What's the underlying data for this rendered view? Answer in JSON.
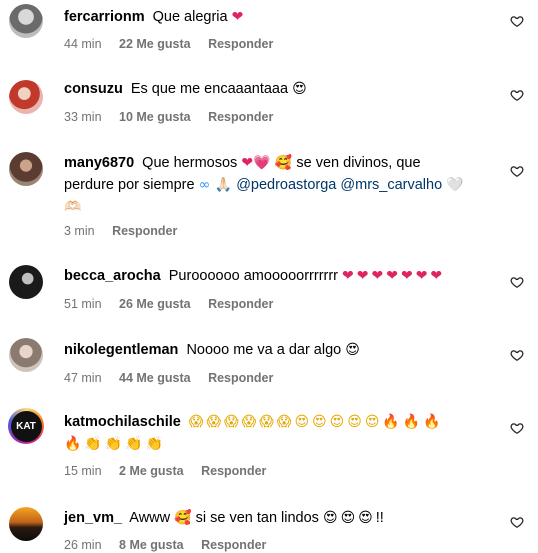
{
  "colors": {
    "muted": "#737373",
    "mention": "#00376b",
    "heart_red": "#e0245e"
  },
  "comments": [
    {
      "username": "fercarrionm",
      "text": "Que alegria",
      "emojis": "❤",
      "time": "44 min",
      "likes": "22 Me gusta",
      "reply": "Responder"
    },
    {
      "username": "consuzu",
      "text": "Es que me encaaantaaa",
      "emojis": "😍",
      "time": "33 min",
      "likes": "10 Me gusta",
      "reply": "Responder"
    },
    {
      "username": "many6870",
      "text1": "Que hermosos",
      "emojis1": "❤💗 🥰",
      "text2": "se ven divinos, que",
      "text3": "perdure por siempre",
      "emojis3": "∞ 🙏🏻",
      "mention1": "@pedroastorga",
      "mention2": "@mrs_carvalho",
      "emojis4": "🤍",
      "emojis5": "🫶🏻",
      "time": "3 min",
      "reply": "Responder"
    },
    {
      "username": "becca_arocha",
      "text": "Puroooooo amooooorrrrrrr",
      "emojis": "❤❤❤❤❤❤❤",
      "time": "51 min",
      "likes": "26 Me gusta",
      "reply": "Responder"
    },
    {
      "username": "nikolegentleman",
      "text": "Noooo me va a dar algo",
      "emojis": "😍",
      "time": "47 min",
      "likes": "44 Me gusta",
      "reply": "Responder"
    },
    {
      "username": "katmochilaschile",
      "avatar_text": "KAT",
      "emojis1": "😱😱😱😱😱😱😍😍😍😍😍🔥🔥🔥",
      "emojis2": "🔥👏👏👏👏",
      "time": "15 min",
      "likes": "2 Me gusta",
      "reply": "Responder"
    },
    {
      "username": "jen_vm_",
      "text1": "Awww",
      "emojis1": "🥰",
      "text2": "si se ven tan lindos",
      "emojis2": "😍😍😍",
      "text3": "!!",
      "time": "26 min",
      "likes": "8 Me gusta",
      "reply": "Responder"
    }
  ]
}
